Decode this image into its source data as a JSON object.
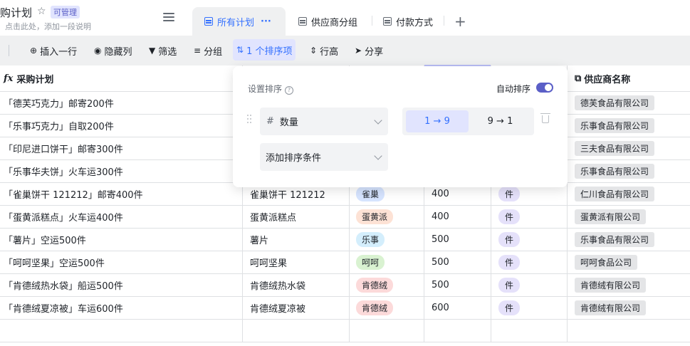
{
  "header": {
    "title": "购计划",
    "badge": "可管理",
    "description": "点击此处，添加一段说明"
  },
  "tabs": [
    {
      "label": "所有计划",
      "more": "···",
      "active": true
    },
    {
      "label": "供应商分组",
      "active": false
    },
    {
      "label": "付款方式",
      "active": false
    }
  ],
  "add_tab": "+",
  "toolbar": {
    "insert_row": "插入一行",
    "hide_cols": "隐藏列",
    "filter": "筛选",
    "group": "分组",
    "sort": "1 个排序项",
    "row_height": "行高",
    "share": "分享"
  },
  "columns": {
    "plan": "采购计划",
    "supplier": "供应商名称"
  },
  "rows": [
    {
      "plan": "「德芙巧克力」邮寄200件",
      "supplier": "德芙食品有限公司"
    },
    {
      "plan": "「乐事巧克力」自取200件",
      "supplier": "乐事食品有限公司"
    },
    {
      "plan": "「印尼进口饼干」邮寄300件",
      "supplier": "三夫食品有限公司"
    },
    {
      "plan": "「乐事华夫饼」火车运300件",
      "supplier": "乐事食品有限公司"
    },
    {
      "plan": "「雀巢饼干 121212」邮寄400件",
      "product": "雀巢饼干 121212",
      "brand": "雀巢",
      "brand_color": "#d6e4ff",
      "qty": "400",
      "unit": "件",
      "supplier": "仁川食品有限公司"
    },
    {
      "plan": "「蛋黄派糕点」火车运400件",
      "product": "蛋黄派糕点",
      "brand": "蛋黄派",
      "brand_color": "#fde2d5",
      "qty": "400",
      "unit": "件",
      "supplier": "蛋黄派有限公司"
    },
    {
      "plan": "「薯片」空运500件",
      "product": "薯片",
      "brand": "乐事",
      "brand_color": "#d4eefc",
      "qty": "500",
      "unit": "件",
      "supplier": "乐事食品有限公司"
    },
    {
      "plan": "「呵呵坚果」空运500件",
      "product": "呵呵坚果",
      "brand": "呵呵",
      "brand_color": "#d9f2d1",
      "qty": "500",
      "unit": "件",
      "supplier": "呵呵食品公司"
    },
    {
      "plan": "「肯德绒热水袋」船运500件",
      "product": "肯德绒热水袋",
      "brand": "肯德绒",
      "brand_color": "#fcdada",
      "qty": "500",
      "unit": "件",
      "supplier": "肯德绒有限公司"
    },
    {
      "plan": "「肯德绒夏凉被」车运600件",
      "product": "肯德绒夏凉被",
      "brand": "肯德绒",
      "brand_color": "#fcdada",
      "qty": "600",
      "unit": "件",
      "supplier": "肯德绒有限公司"
    }
  ],
  "sort_popup": {
    "title": "设置排序",
    "help": "?",
    "auto_sort": "自动排序",
    "auto_sort_on": true,
    "field": "数量",
    "asc": "1 → 9",
    "desc": "9 → 1",
    "add_condition": "添加排序条件"
  },
  "colors": {
    "accent": "#3370ff",
    "toggle": "#5b5fc7",
    "toolbar_bg": "#eff0f1"
  }
}
